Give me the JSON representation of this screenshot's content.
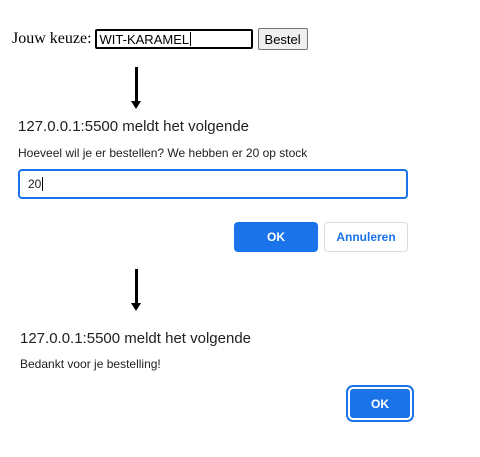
{
  "order_form": {
    "label": "Jouw keuze:",
    "input_value": "WIT-KARAMEL",
    "button_label": "Bestel"
  },
  "prompt_dialog": {
    "title": "127.0.0.1:5500 meldt het volgende",
    "message": "Hoeveel wil je er bestellen? We hebben er 20 op stock",
    "input_value": "20",
    "ok_label": "OK",
    "cancel_label": "Annuleren"
  },
  "alert_dialog": {
    "title": "127.0.0.1:5500 meldt het volgende",
    "message": "Bedankt voor je bestelling!",
    "ok_label": "OK"
  },
  "colors": {
    "accent": "#1a73e8",
    "text": "#202124"
  }
}
